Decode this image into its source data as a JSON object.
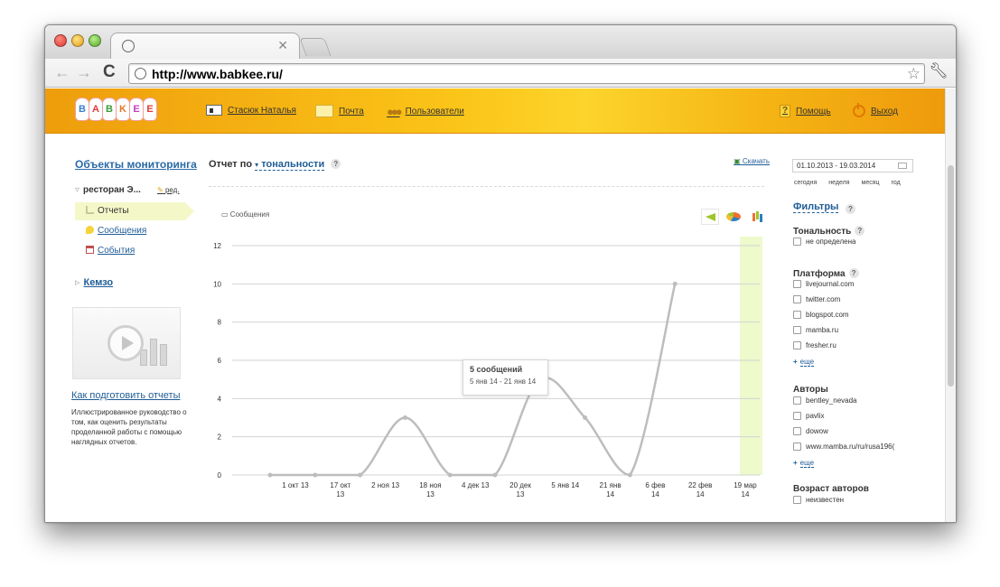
{
  "browser": {
    "url": "http://www.babkee.ru/"
  },
  "site": {
    "logo_letters": [
      "B",
      "A",
      "B",
      "K",
      "E",
      "E"
    ],
    "logo_colors": [
      "#3a7fd0",
      "#e03a3a",
      "#3a9a3a",
      "#e07a20",
      "#c040c0",
      "#e03a3a"
    ],
    "nav": {
      "user": "Стасюк Наталья",
      "mail": "Почта",
      "users": "Пользователи",
      "help": "Помощь",
      "logout": "Выход"
    }
  },
  "left": {
    "title": "Объекты мониторинга",
    "object_name": "ресторан Э...",
    "edit": "ред.",
    "menu": [
      "Отчеты",
      "Сообщения",
      "События"
    ],
    "second_object": "Кемзо",
    "howto_title": "Как подготовить отчеты",
    "howto_desc": "Иллюстрированное руководство о том, как оценить результаты проделанной работы с помощью наглядных отчетов."
  },
  "main": {
    "title_prefix": "Отчет по",
    "title_dropdown": "тональности",
    "help": "?",
    "download": "Скачать",
    "series_label": "Сообщения",
    "tooltip": {
      "title": "5 сообщений",
      "range": "5 янв 14 - 21 янв 14"
    }
  },
  "chart_data": {
    "type": "line",
    "title": "",
    "xlabel": "",
    "ylabel": "",
    "ylim": [
      0,
      12
    ],
    "yticks": [
      0,
      2,
      4,
      6,
      8,
      10,
      12
    ],
    "x_tick_labels": [
      [
        "1 окт 13"
      ],
      [
        "17 окт",
        "13"
      ],
      [
        "2 ноя 13"
      ],
      [
        "18 ноя",
        "13"
      ],
      [
        "4 дек 13"
      ],
      [
        "20 дек",
        "13"
      ],
      [
        "5 янв 14"
      ],
      [
        "21 янв",
        "14"
      ],
      [
        "6 фев",
        "14"
      ],
      [
        "22 фев",
        "14"
      ],
      [
        "19 мар",
        "14"
      ]
    ],
    "series": [
      {
        "name": "Сообщения",
        "x": [
          "1 окт 13",
          "17 окт 13",
          "2 ноя 13",
          "18 ноя 13",
          "4 дек 13",
          "20 дек 13",
          "5 янв 14",
          "21 янв 14",
          "6 фев 14",
          "22 фев 14",
          "19 мар 14"
        ],
        "values": [
          0,
          0,
          0,
          3,
          0,
          0,
          5,
          3,
          0,
          10,
          null
        ]
      }
    ],
    "highlight_period": "19 мар 14",
    "colors": {
      "line": "#bdbdbd",
      "highlight": "#eef9cc"
    }
  },
  "right": {
    "date_range": "01.10.2013 - 19.03.2014",
    "periods": [
      "сегодня",
      "неделя",
      "месяц",
      "год"
    ],
    "filters_title": "Фильтры",
    "sentiment_title": "Тональность",
    "sentiment_items": [
      "не определена"
    ],
    "platform_title": "Платформа",
    "platform_items": [
      "livejournal.com",
      "twitter.com",
      "blogspot.com",
      "mamba.ru",
      "fresher.ru"
    ],
    "more": "еще",
    "authors_title": "Авторы",
    "authors_items": [
      "bentley_nevada",
      "pavlix",
      "dowow",
      "www.mamba.ru/ru/rusa196("
    ],
    "age_title": "Возраст авторов",
    "age_items": [
      "неизвестен"
    ]
  }
}
